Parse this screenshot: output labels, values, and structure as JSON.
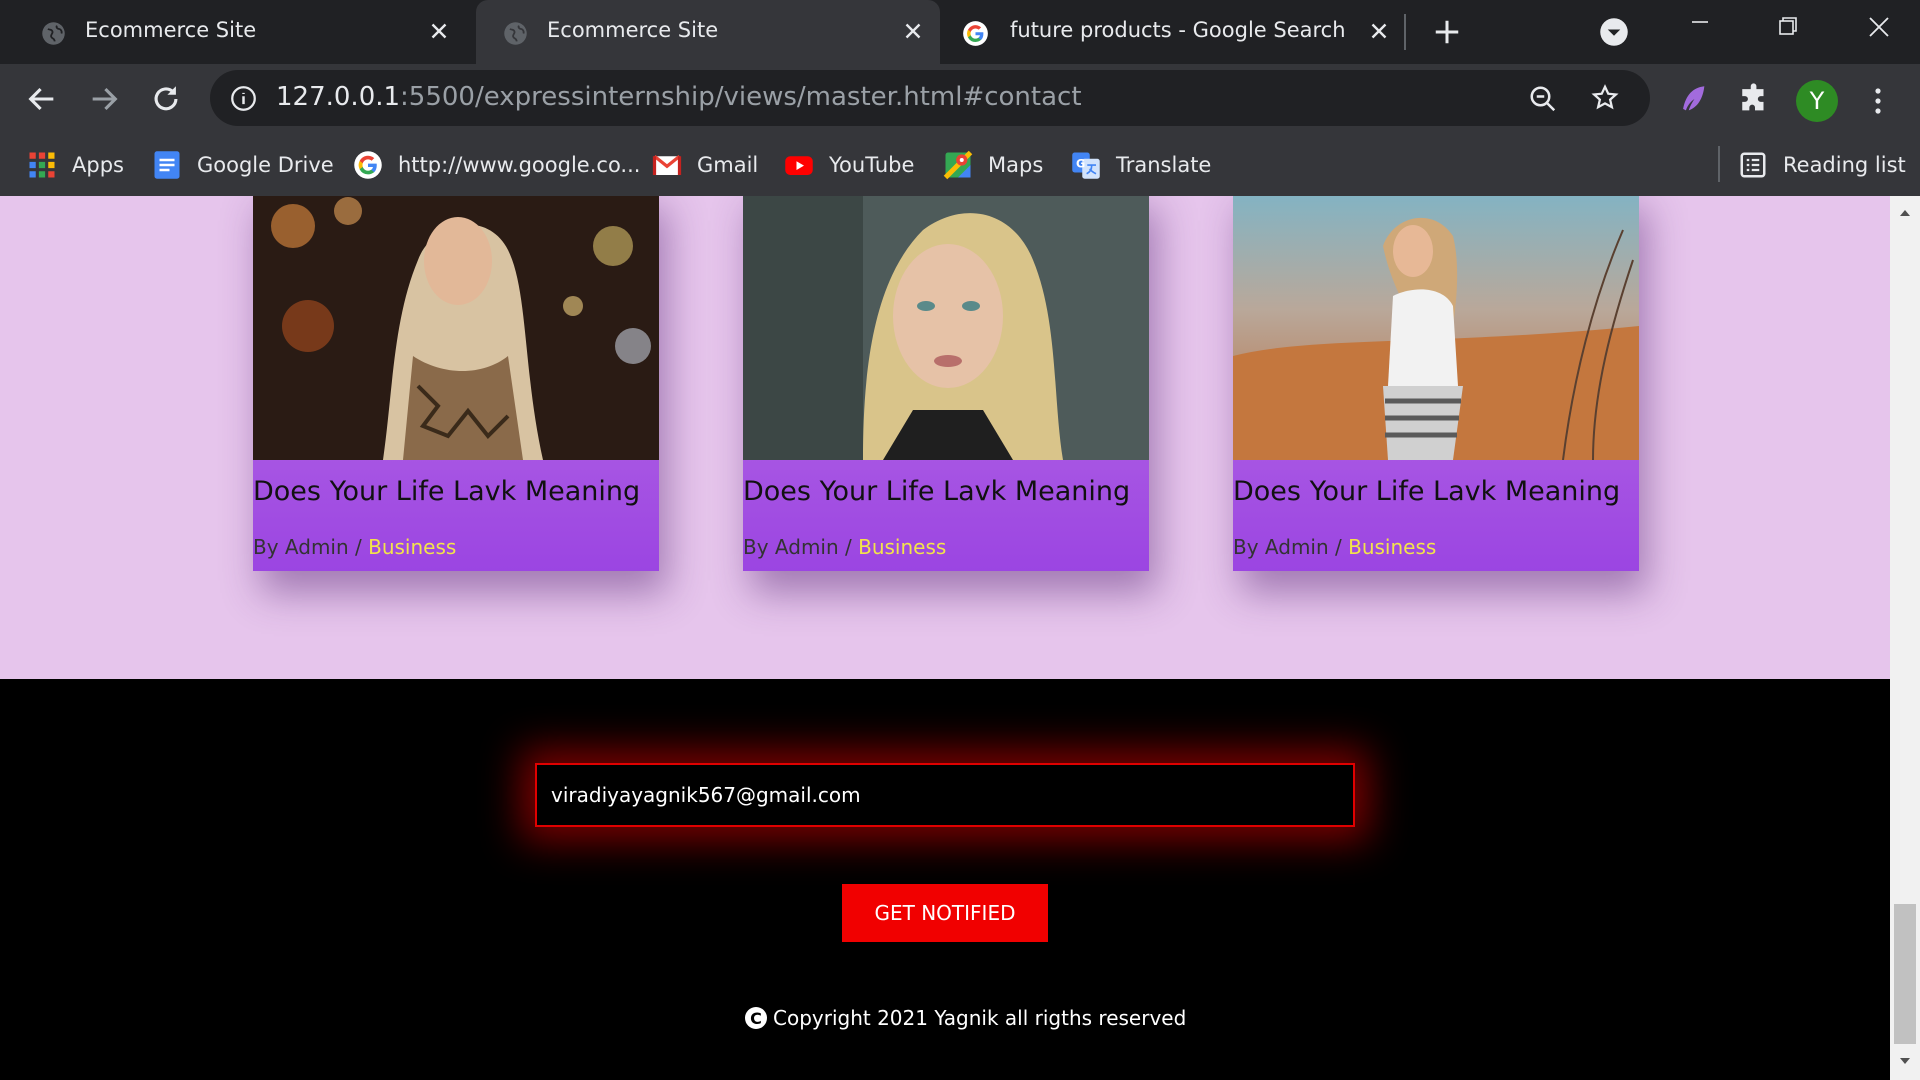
{
  "browser": {
    "tabs": [
      {
        "title": "Ecommerce Site",
        "icon": "globe-icon",
        "active": false
      },
      {
        "title": "Ecommerce Site",
        "icon": "globe-icon",
        "active": true
      },
      {
        "title": "future products - Google Search",
        "icon": "google-icon",
        "active": false
      }
    ],
    "url_host": "127.0.0.1",
    "url_rest": ":5500/expressinternship/views/master.html#contact",
    "profile_initial": "Y"
  },
  "bookmarks": [
    {
      "label": "Apps",
      "icon": "apps-grid-icon"
    },
    {
      "label": "Google Drive",
      "icon": "google-drive-icon"
    },
    {
      "label": "http://www.google.co...",
      "icon": "google-icon"
    },
    {
      "label": "Gmail",
      "icon": "gmail-icon"
    },
    {
      "label": "YouTube",
      "icon": "youtube-icon"
    },
    {
      "label": "Maps",
      "icon": "maps-icon"
    },
    {
      "label": "Translate",
      "icon": "translate-icon"
    }
  ],
  "reading_list": "Reading list",
  "blog": {
    "cards": [
      {
        "title": "Does Your Life Lavk Meaning",
        "meta": "By Admin / ",
        "category": "Business"
      },
      {
        "title": "Does Your Life Lavk Meaning",
        "meta": "By Admin / ",
        "category": "Business"
      },
      {
        "title": "Does Your Life Lavk Meaning",
        "meta": "By Admin / ",
        "category": "Business"
      }
    ]
  },
  "newsletter": {
    "email_value": "viradiyayagnik567@gmail.com",
    "button_label": "GET NOTIFIED"
  },
  "footer": {
    "copyright": "Copyright 2021 Yagnik all rigths reserved"
  },
  "colors": {
    "blog_bg": "#e6c5ec",
    "card_gradient_top": "#c47ce5",
    "card_gradient_bottom": "#9b45e2",
    "category_color": "#f3e34a",
    "accent_red": "#f10000"
  }
}
